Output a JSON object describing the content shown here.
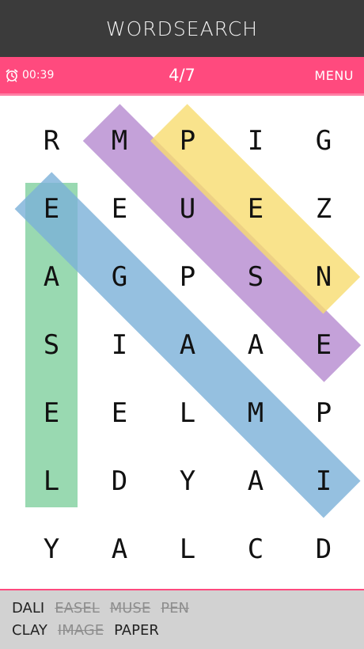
{
  "header": {
    "title": "WORDSEARCH"
  },
  "status": {
    "timer": "00:39",
    "progress": "4/7",
    "menu_label": "MENU"
  },
  "grid": [
    [
      "R",
      "M",
      "P",
      "I",
      "G"
    ],
    [
      "E",
      "E",
      "U",
      "E",
      "Z"
    ],
    [
      "A",
      "G",
      "P",
      "S",
      "N"
    ],
    [
      "S",
      "I",
      "A",
      "A",
      "E"
    ],
    [
      "E",
      "E",
      "L",
      "M",
      "P"
    ],
    [
      "L",
      "D",
      "Y",
      "A",
      "I"
    ],
    [
      "Y",
      "A",
      "L",
      "C",
      "D"
    ]
  ],
  "highlights": [
    {
      "word": "EASEL",
      "color": "#7fcf9e",
      "from": [
        1,
        0
      ],
      "to": [
        5,
        0
      ]
    },
    {
      "word": "IMAGE",
      "color": "#7bb0d8",
      "from": [
        1,
        0
      ],
      "to": [
        5,
        4
      ]
    },
    {
      "word": "MUSE",
      "color": "#b58ad0",
      "from": [
        0,
        1
      ],
      "to": [
        3,
        4
      ]
    },
    {
      "word": "PEN",
      "color": "#f7dc6f",
      "from": [
        0,
        2
      ],
      "to": [
        2,
        4
      ]
    }
  ],
  "words": {
    "row1": [
      {
        "text": "DALI",
        "found": false
      },
      {
        "text": "EASEL",
        "found": true
      },
      {
        "text": "MUSE",
        "found": true
      },
      {
        "text": "PEN",
        "found": true
      }
    ],
    "row2": [
      {
        "text": "CLAY",
        "found": false
      },
      {
        "text": "IMAGE",
        "found": true
      },
      {
        "text": "PAPER",
        "found": false
      }
    ]
  }
}
